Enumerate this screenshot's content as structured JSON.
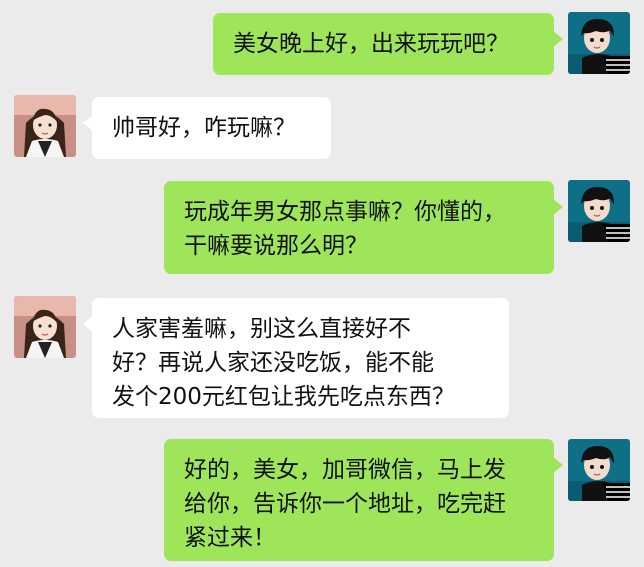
{
  "messages": [
    {
      "sender": "me",
      "lines": [
        "美女晚上好，出来玩玩吧？"
      ]
    },
    {
      "sender": "them",
      "lines": [
        "帅哥好，咋玩嘛？"
      ]
    },
    {
      "sender": "me",
      "lines": [
        "玩成年男女那点事嘛？你懂的，",
        "干嘛要说那么明？"
      ]
    },
    {
      "sender": "them",
      "lines": [
        "人家害羞嘛，别这么直接好不",
        "好？再说人家还没吃饭，能不能",
        "发个200元红包让我先吃点东西？"
      ]
    },
    {
      "sender": "me",
      "lines": [
        "好的，美女，加哥微信，马上发",
        "给你，告诉你一个地址，吃完赶",
        "紧过来！"
      ]
    }
  ],
  "colors": {
    "background": "#ebebeb",
    "sent_bubble": "#9fe55a",
    "received_bubble": "#ffffff"
  },
  "icons": {
    "sent_avatar": "male-cartoon-avatar-icon",
    "received_avatar": "female-photo-avatar-icon"
  }
}
